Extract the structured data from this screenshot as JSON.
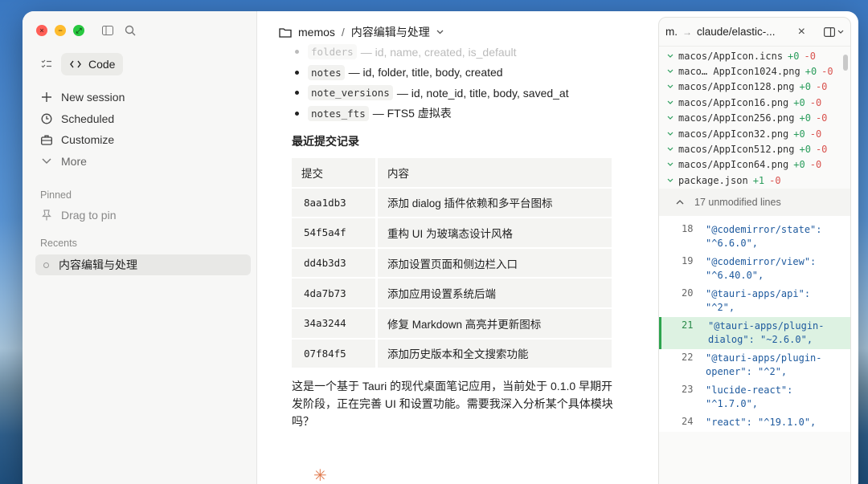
{
  "sidebar": {
    "mode_label": "Code",
    "nav": [
      {
        "icon": "plus-icon",
        "label": "New session"
      },
      {
        "icon": "clock-icon",
        "label": "Scheduled"
      },
      {
        "icon": "briefcase-icon",
        "label": "Customize"
      },
      {
        "icon": "chevron-down-icon",
        "label": "More"
      }
    ],
    "pinned_label": "Pinned",
    "pin_item": "Drag to pin",
    "recents_label": "Recents",
    "recent_item": "内容编辑与处理"
  },
  "main": {
    "breadcrumb": {
      "folder": "memos",
      "separator": "/",
      "page": "内容编辑与处理"
    },
    "schema_items": [
      {
        "code": "folders",
        "desc": "— id, name, created, is_default"
      },
      {
        "code": "notes",
        "desc": "— id, folder, title, body, created"
      },
      {
        "code": "note_versions",
        "desc": "— id, note_id, title, body, saved_at"
      },
      {
        "code": "notes_fts",
        "desc": "— FTS5 虚拟表"
      }
    ],
    "section_heading": "最近提交记录",
    "table_headers": [
      "提交",
      "内容"
    ],
    "commits": [
      {
        "hash": "8aa1db3",
        "msg": "添加 dialog 插件依赖和多平台图标"
      },
      {
        "hash": "54f5a4f",
        "msg": "重构 UI 为玻璃态设计风格"
      },
      {
        "hash": "dd4b3d3",
        "msg": "添加设置页面和侧边栏入口"
      },
      {
        "hash": "4da7b73",
        "msg": "添加应用设置系统后端"
      },
      {
        "hash": "34a3244",
        "msg": "修复 Markdown 高亮并更新图标"
      },
      {
        "hash": "07f84f5",
        "msg": "添加历史版本和全文搜索功能"
      }
    ],
    "summary": "这是一个基于 Tauri 的现代桌面笔记应用，当前处于 0.1.0 早期开发阶段，正在完善 UI 和设置功能。需要我深入分析某个具体模块吗？",
    "spinner": "✳"
  },
  "panel": {
    "tab_short": "m.",
    "title": "claude/elastic-...",
    "files": [
      {
        "name": "macos/AppIcon.icns",
        "add": "+0",
        "del": "-0"
      },
      {
        "name": "maco… AppIcon1024.png",
        "add": "+0",
        "del": "-0"
      },
      {
        "name": "macos/AppIcon128.png",
        "add": "+0",
        "del": "-0"
      },
      {
        "name": "macos/AppIcon16.png",
        "add": "+0",
        "del": "-0"
      },
      {
        "name": "macos/AppIcon256.png",
        "add": "+0",
        "del": "-0"
      },
      {
        "name": "macos/AppIcon32.png",
        "add": "+0",
        "del": "-0"
      },
      {
        "name": "macos/AppIcon512.png",
        "add": "+0",
        "del": "-0"
      },
      {
        "name": "macos/AppIcon64.png",
        "add": "+0",
        "del": "-0"
      },
      {
        "name": "package.json",
        "add": "+1",
        "del": "-0"
      }
    ],
    "unmodified": "17 unmodified lines",
    "diff_lines": [
      {
        "num": "18",
        "code": "\"@codemirror/state\": \"^6.6.0\",",
        "added": false
      },
      {
        "num": "19",
        "code": "\"@codemirror/view\": \"^6.40.0\",",
        "added": false
      },
      {
        "num": "20",
        "code": "    \"@tauri-apps/api\": \"^2\",",
        "added": false
      },
      {
        "num": "21",
        "code": "    \"@tauri-apps/plugin-dialog\": \"~2.6.0\",",
        "added": true
      },
      {
        "num": "22",
        "code": "    \"@tauri-apps/plugin-opener\": \"^2\",",
        "added": false
      },
      {
        "num": "23",
        "code": "    \"lucide-react\": \"^1.7.0\",",
        "added": false
      },
      {
        "num": "24",
        "code": "    \"react\": \"^19.1.0\",",
        "added": false
      }
    ]
  }
}
